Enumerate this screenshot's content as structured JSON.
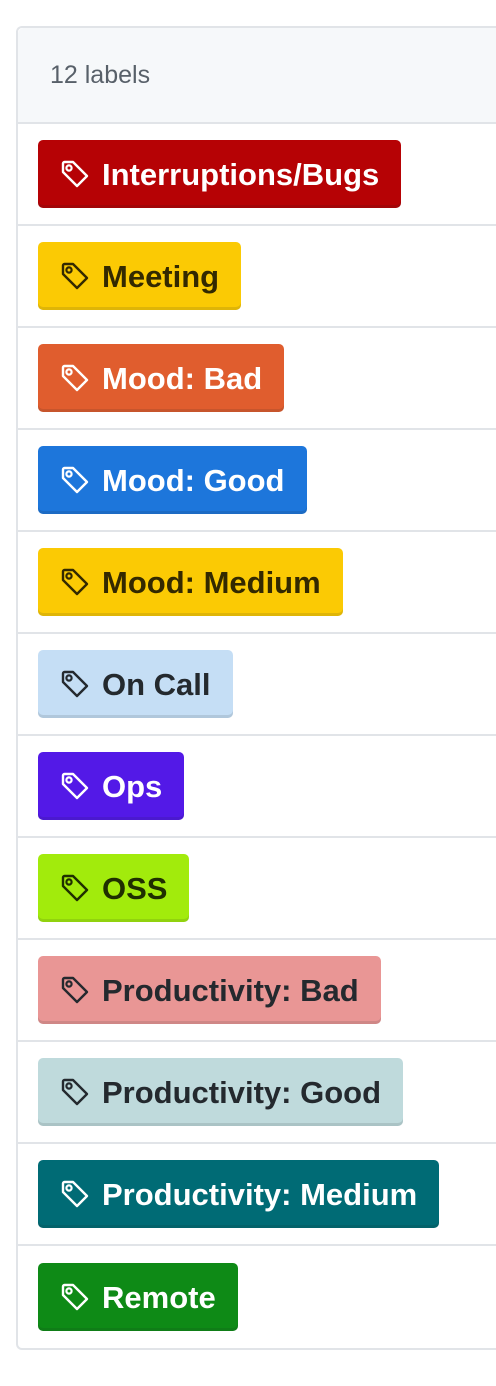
{
  "header": {
    "count_text": "12 labels"
  },
  "labels": [
    {
      "name": "Interruptions/Bugs",
      "bg": "#b60205",
      "fg": "#ffffff"
    },
    {
      "name": "Meeting",
      "bg": "#fbca04",
      "fg": "#332900"
    },
    {
      "name": "Mood: Bad",
      "bg": "#e05d2e",
      "fg": "#ffffff"
    },
    {
      "name": "Mood: Good",
      "bg": "#1d76db",
      "fg": "#ffffff"
    },
    {
      "name": "Mood: Medium",
      "bg": "#fbca04",
      "fg": "#332900"
    },
    {
      "name": "On Call",
      "bg": "#c5def5",
      "fg": "#24292e"
    },
    {
      "name": "Ops",
      "bg": "#5319e7",
      "fg": "#ffffff"
    },
    {
      "name": "OSS",
      "bg": "#a2eb0c",
      "fg": "#1f2f00"
    },
    {
      "name": "Productivity: Bad",
      "bg": "#e99695",
      "fg": "#24292e"
    },
    {
      "name": "Productivity: Good",
      "bg": "#bfdadc",
      "fg": "#24292e"
    },
    {
      "name": "Productivity: Medium",
      "bg": "#006b75",
      "fg": "#ffffff"
    },
    {
      "name": "Remote",
      "bg": "#0e8a16",
      "fg": "#ffffff"
    }
  ],
  "icons": {
    "label_icon": "tag-icon"
  }
}
